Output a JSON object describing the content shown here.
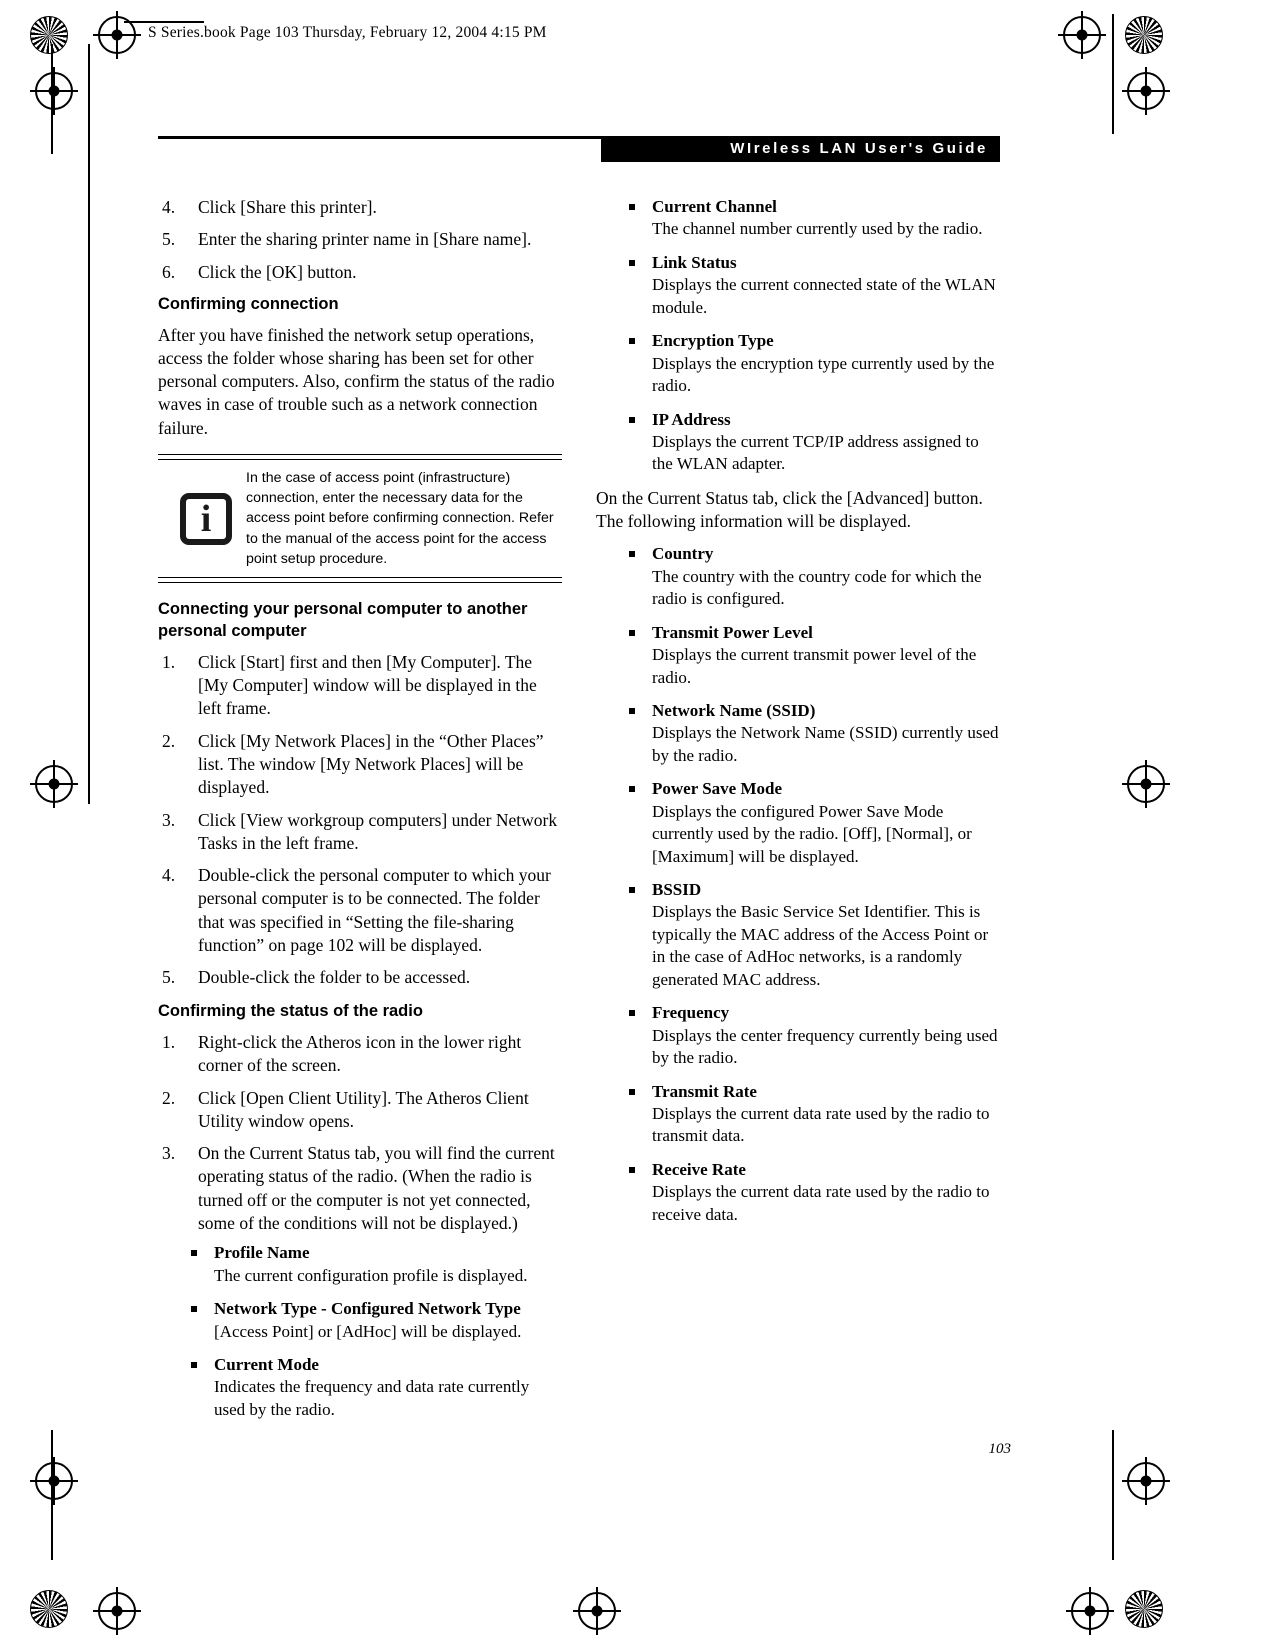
{
  "file_header": "S Series.book  Page 103  Thursday, February 12, 2004  4:15 PM",
  "running_head": "WIreless LAN User's Guide",
  "folio": "103",
  "colors": {
    "banner_bg": "#000000",
    "banner_text": "#ffffff",
    "rule": "#000000"
  },
  "left_column": {
    "steps_printer": [
      {
        "num": "4.",
        "text": "Click [Share this printer]."
      },
      {
        "num": "5.",
        "text": "Enter the sharing printer name in [Share name]."
      },
      {
        "num": "6.",
        "text": "Click the [OK] button."
      }
    ],
    "heading_confirming_connection": "Confirming connection",
    "paragraph_confirming_connection": "After you have finished the network setup operations, access the folder whose sharing has been set for other personal computers. Also, confirm the status of the radio waves in case of trouble such as a network connection failure.",
    "note": {
      "icon": "info-icon",
      "icon_glyph": "i",
      "text": "In the case of access point (infrastructure) connection, enter the necessary data for the access point before confirming connection. Refer to the manual of the access point for the access point setup procedure."
    },
    "heading_connecting": "Connecting your personal computer to another personal computer",
    "steps_connecting": [
      {
        "num": "1.",
        "text": "Click [Start] first and then [My Computer]. The [My Computer] window will be displayed in the left frame."
      },
      {
        "num": "2.",
        "text": "Click [My Network Places] in the “Other Places” list. The window [My Network Places] will be displayed."
      },
      {
        "num": "3.",
        "text": "Click [View workgroup computers] under Network Tasks in the left frame."
      },
      {
        "num": "4.",
        "text": "Double-click the personal computer to which your personal computer is to be connected. The folder that was specified in “Setting the file-sharing function” on page 102 will be displayed."
      },
      {
        "num": "5.",
        "text": "Double-click the folder to be accessed."
      }
    ],
    "heading_status": "Confirming the status of the radio",
    "steps_status": [
      {
        "num": "1.",
        "text": "Right-click the Atheros icon in the lower right corner of the screen."
      },
      {
        "num": "2.",
        "text": "Click [Open Client Utility]. The Atheros Client Utility window opens."
      },
      {
        "num": "3.",
        "text": "On the Current Status tab, you will find the current operating status of the radio. (When the radio is turned off or the computer is not yet connected, some of the conditions will not be displayed.)"
      }
    ],
    "status_items": [
      {
        "term": "Profile Name",
        "def": "The current configuration profile is displayed."
      },
      {
        "term": "Network Type - Configured Network Type",
        "def": "[Access Point] or [AdHoc] will be displayed."
      },
      {
        "term": "Current Mode",
        "def": "Indicates the frequency and data rate currently used by the radio."
      }
    ]
  },
  "right_column": {
    "status_items_continued": [
      {
        "term": "Current Channel",
        "def": "The channel number currently used by the radio."
      },
      {
        "term": "Link Status",
        "def": "Displays the current connected state of the WLAN module."
      },
      {
        "term": "Encryption Type",
        "def": "Displays the encryption type currently used by the radio."
      },
      {
        "term": "IP Address",
        "def": "Displays the current TCP/IP address assigned to the WLAN adapter."
      }
    ],
    "paragraph_advanced": "On the Current Status tab, click the [Advanced] button. The following information will be displayed.",
    "advanced_items": [
      {
        "term": "Country",
        "def": "The country with the country code for which the radio is configured."
      },
      {
        "term": "Transmit Power Level",
        "def": "Displays the current transmit power level of the radio."
      },
      {
        "term": "Network Name (SSID)",
        "def": "Displays the Network Name (SSID) currently used by the radio."
      },
      {
        "term": "Power Save Mode",
        "def": "Displays the configured Power Save Mode currently used by the radio. [Off], [Normal], or [Maximum] will be displayed."
      },
      {
        "term": "BSSID",
        "def": "Displays the Basic Service Set Identifier. This is typically the MAC address of the Access Point or in the case of AdHoc networks, is a randomly generated MAC address."
      },
      {
        "term": "Frequency",
        "def": "Displays the center frequency currently being used by the radio."
      },
      {
        "term": "Transmit Rate",
        "def": "Displays the current data rate used by the radio to transmit data."
      },
      {
        "term": "Receive Rate",
        "def": "Displays the current data rate used by the radio to receive data."
      }
    ]
  }
}
